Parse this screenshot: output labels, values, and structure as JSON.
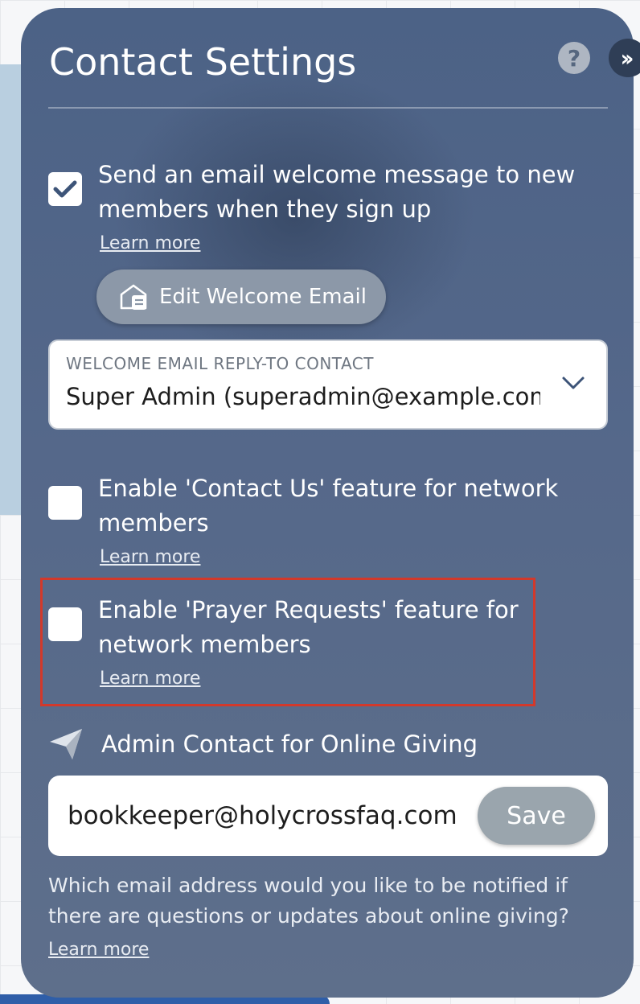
{
  "panel": {
    "title": "Contact Settings",
    "help_icon": "question-circle-icon",
    "collapse_icon": "double-chevron-right-icon"
  },
  "welcome_option": {
    "checked": true,
    "label": "Send an email welcome message to new members when they sign up",
    "learn_more": "Learn more",
    "edit_button_label": "Edit Welcome Email",
    "edit_button_icon": "envelope-open-icon"
  },
  "reply_to": {
    "label": "WELCOME EMAIL REPLY-TO CONTACT",
    "value": "Super Admin (superadmin@example.com)"
  },
  "contact_us_option": {
    "checked": false,
    "label": "Enable 'Contact Us' feature for network members",
    "learn_more": "Learn more"
  },
  "prayer_option": {
    "checked": false,
    "label": "Enable 'Prayer Requests' feature for network members",
    "learn_more": "Learn more",
    "highlight_color": "#d2392b"
  },
  "online_giving": {
    "icon": "paper-plane-icon",
    "label": "Admin Contact for Online Giving",
    "email_value": "bookkeeper@holycrossfaq.com",
    "save_label": "Save",
    "help_text": "Which email address would you like to be notified if there are questions or updates about online giving?",
    "learn_more": "Learn more"
  },
  "colors": {
    "panel_background": "#55688a",
    "accent_check": "#3d5478"
  }
}
